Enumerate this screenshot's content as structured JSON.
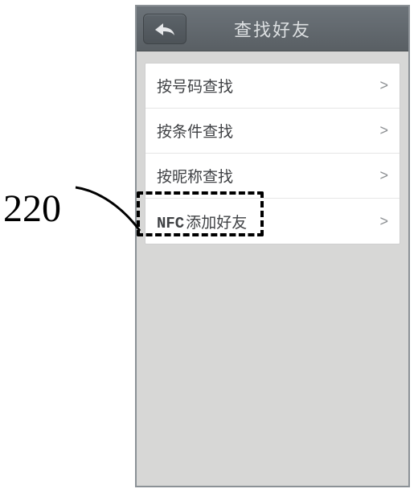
{
  "header": {
    "title": "查找好友",
    "back_icon": "reply-arrow"
  },
  "menu": {
    "items": [
      {
        "label": "按号码查找"
      },
      {
        "label": "按条件查找"
      },
      {
        "label": "按昵称查找"
      },
      {
        "prefix": "NFC",
        "label": "添加好友"
      }
    ],
    "chevron": ">"
  },
  "annotation": {
    "label": "220"
  }
}
